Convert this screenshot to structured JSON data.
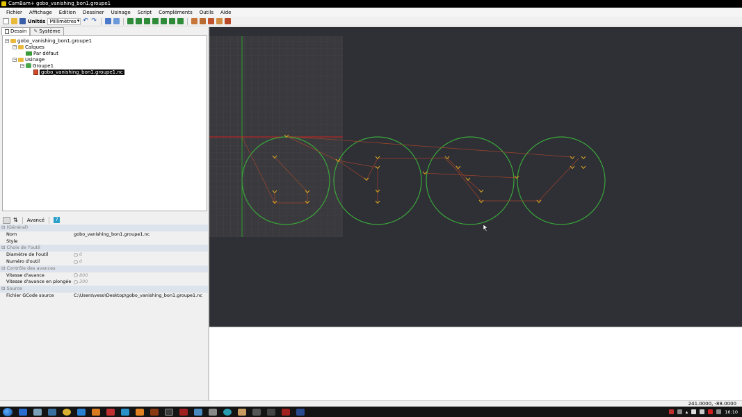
{
  "window": {
    "title": "CamBam+  gobo_vanishing_bon1.groupe1"
  },
  "menu": [
    "Fichier",
    "Affichage",
    "Edition",
    "Dessiner",
    "Usinage",
    "Script",
    "Compléments",
    "Outils",
    "Aide"
  ],
  "toolbar": {
    "units_label": "Unités",
    "units_value": "Millimètres"
  },
  "tabs": {
    "dessin": "Dessin",
    "systeme": "Système"
  },
  "tree": {
    "root": "gobo_vanishing_bon1.groupe1",
    "calques": "Calques",
    "par_defaut": "Par défaut",
    "usinage": "Usinage",
    "groupe": "Groupe1",
    "file": "gobo_vanishing_bon1.groupe1.nc"
  },
  "props_toolbar": {
    "advanced": "Avancé"
  },
  "properties": {
    "general": "(Général)",
    "nom_label": "Nom",
    "nom_value": "gobo_vanishing_bon1.groupe1.nc",
    "style_label": "Style",
    "outil_cat": "Choix de l'outil",
    "diametre_label": "Diamètre de l'outil",
    "diametre_value": "0",
    "numero_label": "Numéro d'outil",
    "numero_value": "0",
    "avances_cat": "Contrôle des avances",
    "vitesse_label": "Vitesse d'avance",
    "vitesse_value": "800",
    "plongee_label": "Vitesse d'avance en plongée",
    "plongee_value": "300",
    "source_cat": "Source",
    "fichier_label": "Fichier GCode source",
    "fichier_value": "C:\\Users\\veso\\Desktop\\gobo_vanishing_bon1.groupe1.nc"
  },
  "status": {
    "coordinates": "241.0000, -88.0000"
  },
  "taskbar": {
    "clock": "16:10"
  },
  "colors": {
    "canvas_bg": "#2f2f36",
    "grid_bg": "#3a3a3e",
    "circle": "#3aa83a",
    "toolpath": "#a0452a",
    "marker": "#d6a820",
    "axis_x": "#d22020",
    "axis_y": "#2aa02a"
  }
}
